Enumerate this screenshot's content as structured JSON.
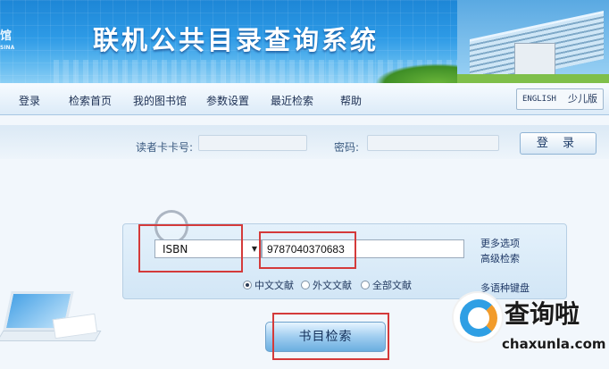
{
  "header": {
    "title": "联机公共目录查询系统",
    "logo_text": "馆",
    "logo_sub": "SINA"
  },
  "nav": {
    "items": [
      "登录",
      "检索首页",
      "我的图书馆",
      "参数设置",
      "最近检索",
      "帮助"
    ],
    "lang_english": "ENGLISH",
    "lang_kids": "少儿版"
  },
  "login": {
    "card_label": "读者卡卡号:",
    "card_value": "",
    "password_label": "密码:",
    "password_value": "",
    "submit_label": "登 录"
  },
  "search": {
    "field_type": "ISBN",
    "query_value": "9787040370683",
    "more_options": "更多选项",
    "advanced": "高级检索",
    "scopes": [
      {
        "label": "中文文献",
        "selected": true
      },
      {
        "label": "外文文献",
        "selected": false
      },
      {
        "label": "全部文献",
        "selected": false
      }
    ],
    "multi_keyboard": "多语种键盘",
    "submit_label": "书目检索"
  },
  "watermark": {
    "name": "查询啦",
    "domain": "chaxunla.com"
  },
  "colors": {
    "banner": "#2d9ae6",
    "highlight_red": "#d43a3a",
    "brand_blue": "#2f9fe4",
    "brand_orange": "#f29b2a"
  }
}
